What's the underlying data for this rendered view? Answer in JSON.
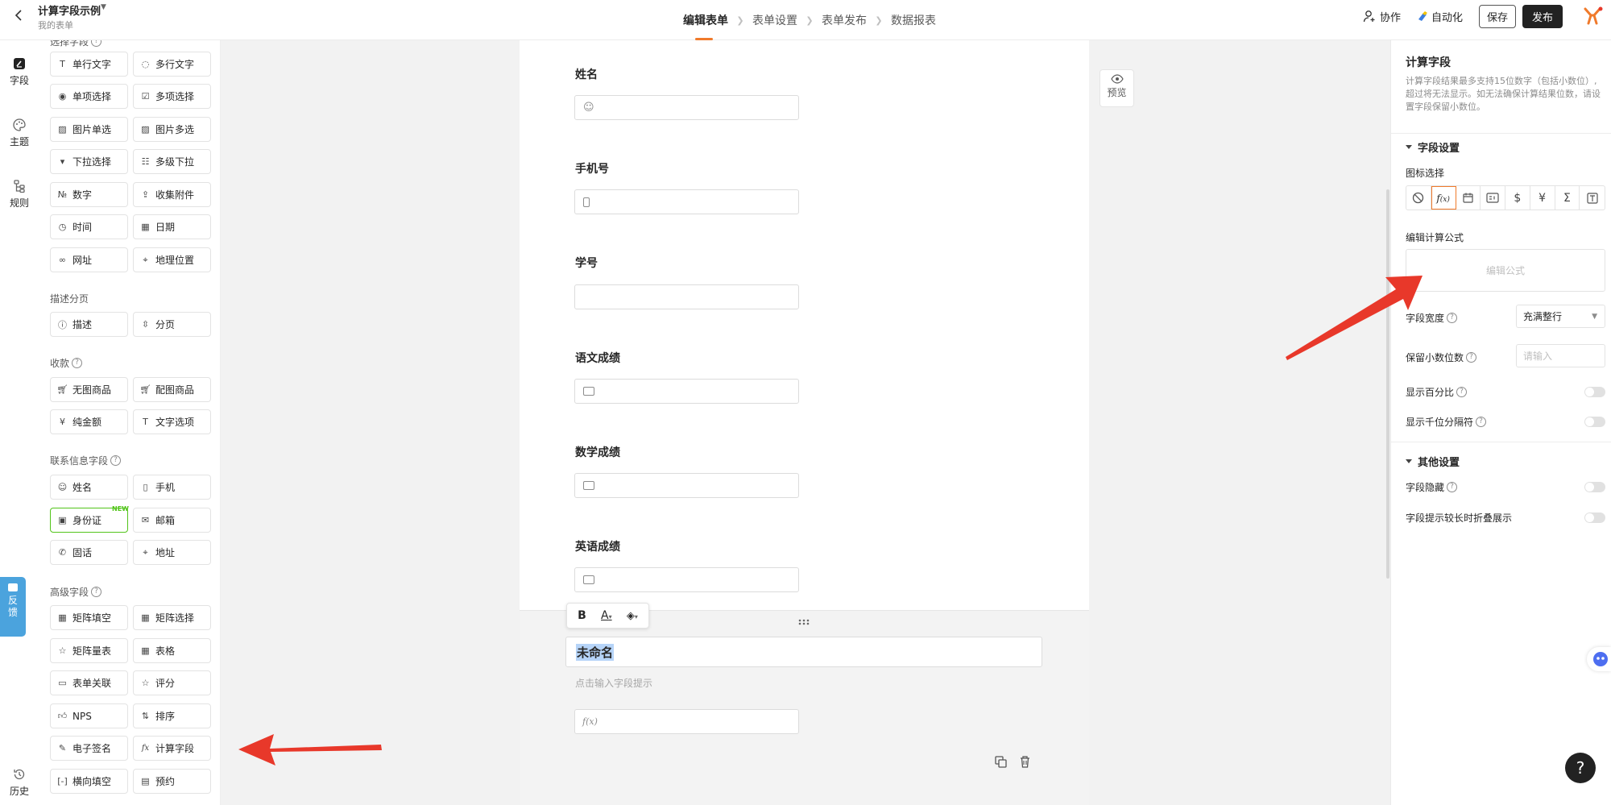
{
  "header": {
    "app_title": "计算字段示例",
    "subtitle": "我的表单",
    "steps": [
      "编辑表单",
      "表单设置",
      "表单发布",
      "数据报表"
    ],
    "active_step": 0,
    "collab": "协作",
    "automation": "自动化",
    "save": "保存",
    "publish": "发布"
  },
  "rail": {
    "items": [
      {
        "label": "字段",
        "icon": "field-edit-icon",
        "active": true
      },
      {
        "label": "主题",
        "icon": "palette-icon"
      },
      {
        "label": "规则",
        "icon": "rules-icon"
      }
    ],
    "history": "历史",
    "feedback": "反馈"
  },
  "components": {
    "partial_group_label": "选择字段",
    "row0": [
      "单行文字",
      "多行文字"
    ],
    "row1": [
      "单项选择",
      "多项选择"
    ],
    "row2": [
      "图片单选",
      "图片多选"
    ],
    "row3": [
      "下拉选择",
      "多级下拉"
    ],
    "row4": [
      "数字",
      "收集附件"
    ],
    "row5": [
      "时间",
      "日期"
    ],
    "row6": [
      "网址",
      "地理位置"
    ],
    "group_describe": "描述分页",
    "describe": [
      "描述",
      "分页"
    ],
    "group_payment": "收款",
    "payment": [
      "无图商品",
      "配图商品",
      "纯金额",
      "文字选项"
    ],
    "group_contact": "联系信息字段",
    "contact": [
      "姓名",
      "手机",
      "身份证",
      "邮箱",
      "固话",
      "地址"
    ],
    "new_badge": "NEW",
    "group_advanced": "高级字段",
    "advanced": [
      "矩阵填空",
      "矩阵选择",
      "矩阵量表",
      "表格",
      "表单关联",
      "评分",
      "NPS",
      "排序",
      "电子签名",
      "计算字段",
      "横向填空",
      "预约"
    ]
  },
  "form": {
    "fields": [
      "姓名",
      "手机号",
      "学号",
      "语文成绩",
      "数学成绩",
      "英语成绩"
    ],
    "active_title": "未命名",
    "hint_placeholder": "点击输入字段提示",
    "calc_icon_text": "f(x)",
    "preview": "预览"
  },
  "settings": {
    "title": "计算字段",
    "desc": "计算字段结果最多支持15位数字（包括小数位）,超过将无法显示。如无法确保计算结果位数，请设置字段保留小数位。",
    "section_field": "字段设置",
    "icon_select": "图标选择",
    "formula_label": "编辑计算公式",
    "formula_placeholder": "编辑公式",
    "width_label": "字段宽度",
    "width_value": "充满整行",
    "decimals_label": "保留小数位数",
    "decimals_placeholder": "请输入",
    "show_percent": "显示百分比",
    "show_thousands": "显示千位分隔符",
    "section_other": "其他设置",
    "hide_field": "字段隐藏",
    "collapse_hint": "字段提示较长时折叠展示",
    "icons": [
      "none-icon",
      "fx-icon",
      "calendar-icon",
      "id-card-icon",
      "dollar-icon",
      "yen-icon",
      "sigma-icon",
      "text-icon"
    ]
  },
  "colors": {
    "accent": "#f07a2b",
    "arrow": "#e8382a",
    "feedback": "#4ba3dd",
    "dark_button": "#222222"
  }
}
